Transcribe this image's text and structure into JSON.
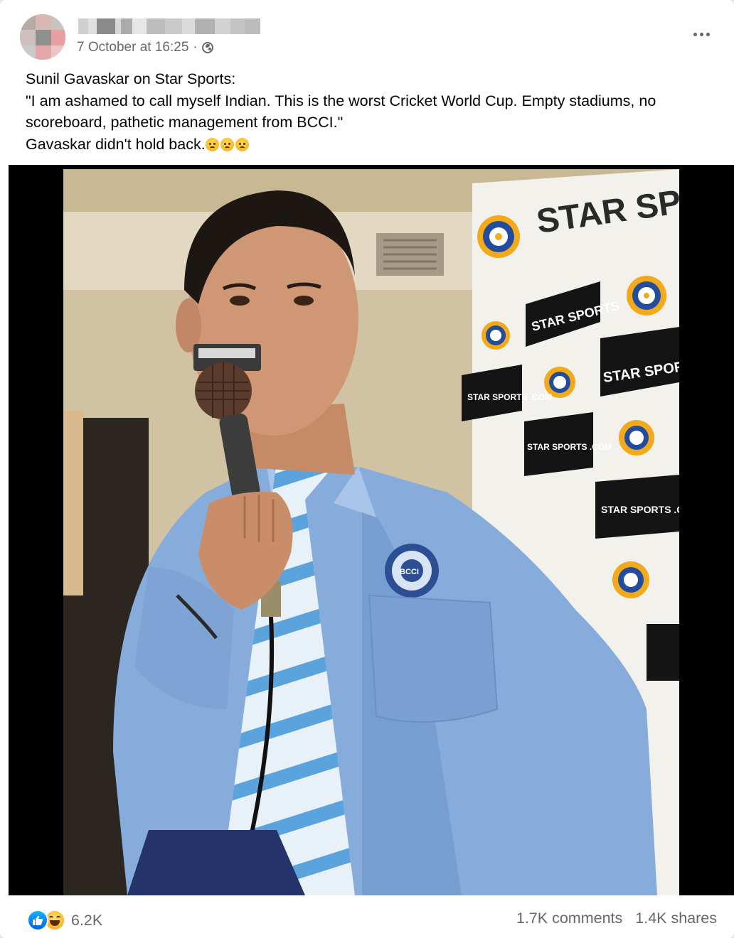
{
  "post": {
    "author_name": "",
    "timestamp": "7 October at 16:25",
    "separator": "·",
    "privacy_icon": "globe-icon",
    "more_icon": "more-options-icon",
    "text_lines": [
      "Sunil Gavaskar on Star Sports:",
      "\"I am ashamed to call myself Indian. This is the worst Cricket World Cup. Empty stadiums, no scoreboard, pathetic management from BCCI.\"",
      "Gavaskar didn't hold back."
    ],
    "text_emojis": [
      "frowning-face",
      "frowning-face",
      "frowning-face"
    ],
    "photo": {
      "backdrop_text": "STAR SPOR",
      "logo_text_1": "STAR SPORTS",
      "logo_text_2": "STAR SPORTS .COM",
      "badge_text": "BCCI"
    }
  },
  "footer": {
    "reaction_icons": [
      "like-reaction-icon",
      "haha-reaction-icon"
    ],
    "reaction_count": "6.2K",
    "comments": "1.7K comments",
    "shares": "1.4K shares"
  },
  "colors": {
    "meta_gray": "#65676b",
    "like_blue": "#0062df",
    "shirt_blue": "#7fa6d8"
  }
}
